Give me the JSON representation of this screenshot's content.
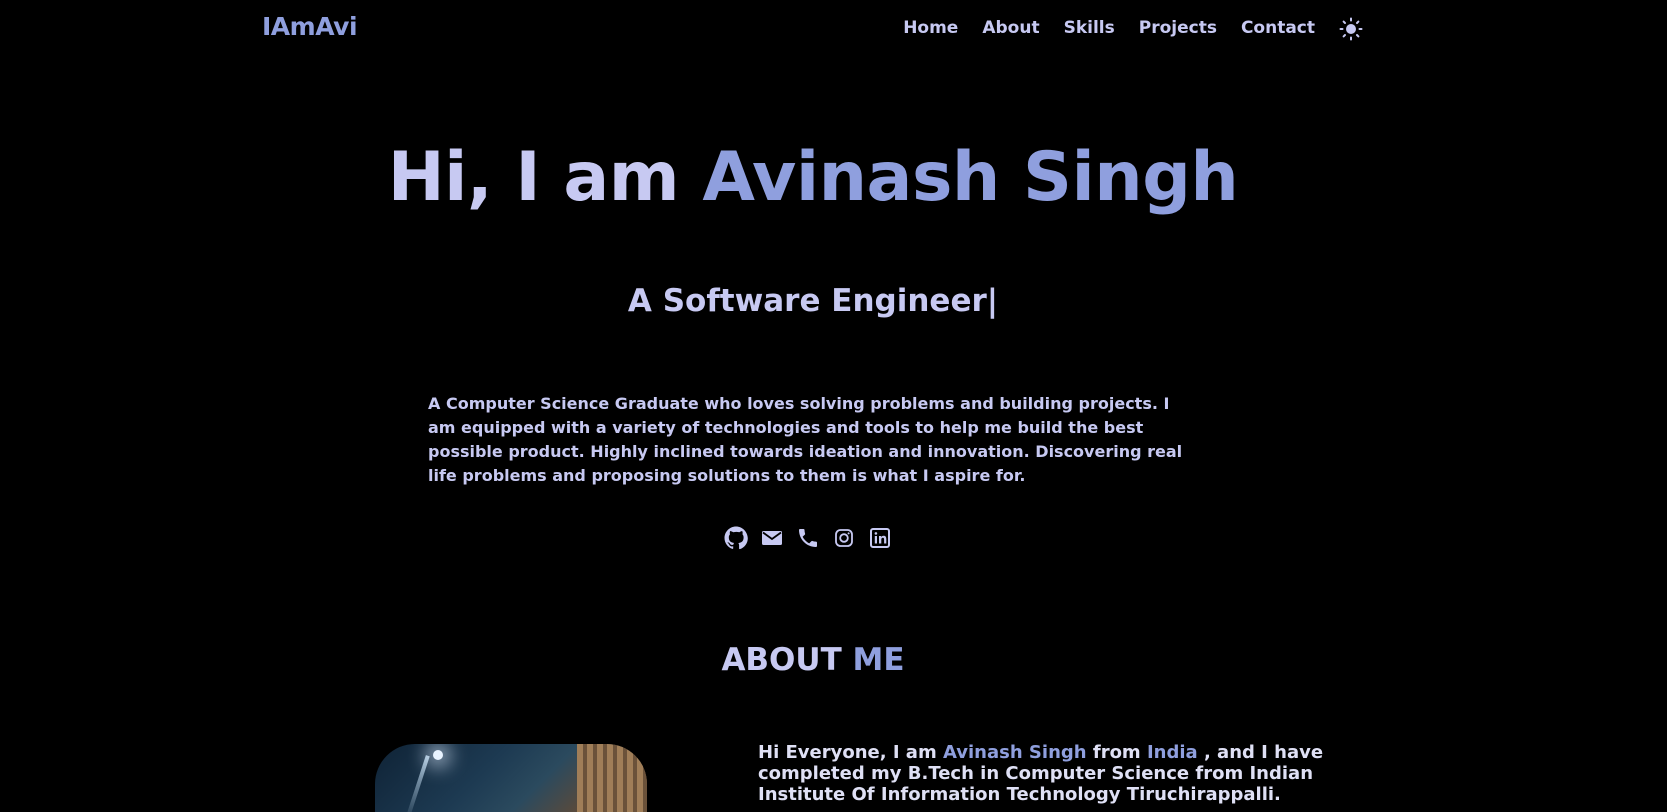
{
  "brand": "IAmAvi",
  "nav": {
    "items": [
      "Home",
      "About",
      "Skills",
      "Projects",
      "Contact"
    ],
    "theme_toggle_icon": "sun-icon"
  },
  "hero": {
    "greeting": "Hi, I am ",
    "name": "Avinash Singh",
    "subtitle": "A Software Engineer",
    "cursor": "|",
    "intro": "A Computer Science Graduate who loves solving problems and building projects. I am equipped with a variety of technologies and tools to help me build the best possible product. Highly inclined towards ideation and innovation. Discovering real life problems and proposing solutions to them is what I aspire for."
  },
  "socials": [
    {
      "icon": "github-icon"
    },
    {
      "icon": "mail-icon"
    },
    {
      "icon": "phone-icon"
    },
    {
      "icon": "instagram-icon"
    },
    {
      "icon": "linkedin-icon"
    }
  ],
  "about": {
    "title_a": "ABOUT ",
    "title_b": "ME",
    "text_1": "Hi Everyone, I am ",
    "name": "Avinash Singh",
    "text_2": " from ",
    "country": "India",
    "text_3": " , and I have completed my B.Tech in Computer Science from Indian Institute Of Information Technology Tiruchirappalli."
  },
  "colors": {
    "background": "#000000",
    "text": "#c7c9f2",
    "accent": "#8f9fde"
  }
}
